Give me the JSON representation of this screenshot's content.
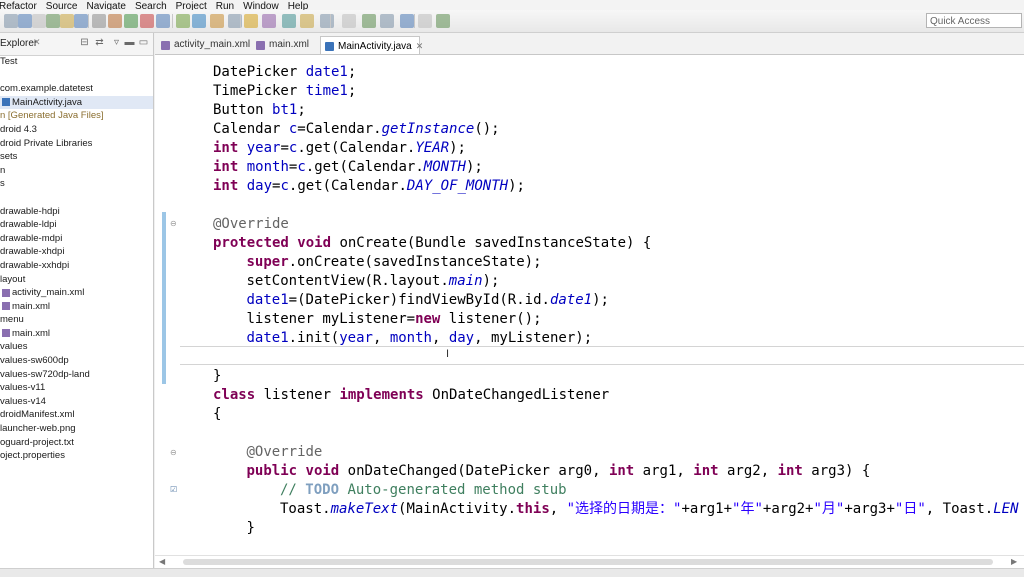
{
  "menu": [
    "Refactor",
    "Source",
    "Navigate",
    "Search",
    "Project",
    "Run",
    "Window",
    "Help"
  ],
  "toolbar": {
    "quick_access_placeholder": "Quick Access"
  },
  "explorer": {
    "tab_label": "Explorer",
    "close_glyph": "✕",
    "items": [
      {
        "label": "Test",
        "indent": 0,
        "icon": "project-icon"
      },
      {
        "label": "",
        "indent": 0,
        "icon": ""
      },
      {
        "label": "com.example.datetest",
        "indent": 0,
        "icon": "package-icon"
      },
      {
        "label": "MainActivity.java",
        "indent": 1,
        "icon": "java-file-icon",
        "selected": true
      },
      {
        "label": "n [Generated Java Files]",
        "indent": 0,
        "icon": "folder-icon",
        "generated": true
      },
      {
        "label": "droid 4.3",
        "indent": 0,
        "icon": "library-icon"
      },
      {
        "label": "droid Private Libraries",
        "indent": 0,
        "icon": "library-icon"
      },
      {
        "label": "sets",
        "indent": 0,
        "icon": "folder-icon"
      },
      {
        "label": "n",
        "indent": 0,
        "icon": "folder-icon"
      },
      {
        "label": "s",
        "indent": 0,
        "icon": "folder-icon"
      },
      {
        "label": "",
        "indent": 0,
        "icon": ""
      },
      {
        "label": "drawable-hdpi",
        "indent": 0,
        "icon": "folder-icon"
      },
      {
        "label": "drawable-ldpi",
        "indent": 0,
        "icon": "folder-icon"
      },
      {
        "label": "drawable-mdpi",
        "indent": 0,
        "icon": "folder-icon"
      },
      {
        "label": "drawable-xhdpi",
        "indent": 0,
        "icon": "folder-icon"
      },
      {
        "label": "drawable-xxhdpi",
        "indent": 0,
        "icon": "folder-icon"
      },
      {
        "label": "layout",
        "indent": 0,
        "icon": "folder-icon"
      },
      {
        "label": "activity_main.xml",
        "indent": 1,
        "icon": "xml-file-icon"
      },
      {
        "label": "main.xml",
        "indent": 1,
        "icon": "xml-file-icon"
      },
      {
        "label": "menu",
        "indent": 0,
        "icon": "folder-icon"
      },
      {
        "label": "main.xml",
        "indent": 1,
        "icon": "xml-file-icon"
      },
      {
        "label": "values",
        "indent": 0,
        "icon": "folder-icon"
      },
      {
        "label": "values-sw600dp",
        "indent": 0,
        "icon": "folder-icon"
      },
      {
        "label": "values-sw720dp-land",
        "indent": 0,
        "icon": "folder-icon"
      },
      {
        "label": "values-v11",
        "indent": 0,
        "icon": "folder-icon"
      },
      {
        "label": "values-v14",
        "indent": 0,
        "icon": "folder-icon"
      },
      {
        "label": "droidManifest.xml",
        "indent": 0,
        "icon": "xml-file-icon"
      },
      {
        "label": "launcher-web.png",
        "indent": 0,
        "icon": "image-file-icon"
      },
      {
        "label": "oguard-project.txt",
        "indent": 0,
        "icon": "text-file-icon"
      },
      {
        "label": "oject.properties",
        "indent": 0,
        "icon": "text-file-icon"
      }
    ]
  },
  "editor": {
    "tabs": [
      {
        "label": "activity_main.xml",
        "active": false
      },
      {
        "label": "main.xml",
        "active": false
      },
      {
        "label": "MainActivity.java",
        "active": true
      }
    ],
    "lines": [
      {
        "indent": 0,
        "tokens": [
          [
            "",
            "DatePicker "
          ],
          [
            "fld",
            "date1"
          ],
          [
            "",
            ";"
          ]
        ]
      },
      {
        "indent": 0,
        "tokens": [
          [
            "",
            "TimePicker "
          ],
          [
            "fld",
            "time1"
          ],
          [
            "",
            ";"
          ]
        ]
      },
      {
        "indent": 0,
        "tokens": [
          [
            "",
            "Button "
          ],
          [
            "fld",
            "bt1"
          ],
          [
            "",
            ";"
          ]
        ]
      },
      {
        "indent": 0,
        "tokens": [
          [
            "",
            "Calendar "
          ],
          [
            "fld",
            "c"
          ],
          [
            "",
            "=Calendar."
          ],
          [
            "stc",
            "getInstance"
          ],
          [
            "",
            "();"
          ]
        ]
      },
      {
        "indent": 0,
        "tokens": [
          [
            "kw",
            "int"
          ],
          [
            "",
            " "
          ],
          [
            "fld",
            "year"
          ],
          [
            "",
            "="
          ],
          [
            "fld",
            "c"
          ],
          [
            "",
            ".get(Calendar."
          ],
          [
            "stc",
            "YEAR"
          ],
          [
            "",
            ");"
          ]
        ]
      },
      {
        "indent": 0,
        "tokens": [
          [
            "kw",
            "int"
          ],
          [
            "",
            " "
          ],
          [
            "fld",
            "month"
          ],
          [
            "",
            "="
          ],
          [
            "fld",
            "c"
          ],
          [
            "",
            ".get(Calendar."
          ],
          [
            "stc",
            "MONTH"
          ],
          [
            "",
            ");"
          ]
        ]
      },
      {
        "indent": 0,
        "tokens": [
          [
            "kw",
            "int"
          ],
          [
            "",
            " "
          ],
          [
            "fld",
            "day"
          ],
          [
            "",
            "="
          ],
          [
            "fld",
            "c"
          ],
          [
            "",
            ".get(Calendar."
          ],
          [
            "stc",
            "DAY_OF_MONTH"
          ],
          [
            "",
            ");"
          ]
        ]
      },
      {
        "indent": 0,
        "tokens": []
      },
      {
        "indent": 0,
        "tokens": [
          [
            "ann",
            "@Override"
          ]
        ]
      },
      {
        "indent": 0,
        "tokens": [
          [
            "kw",
            "protected"
          ],
          [
            "",
            " "
          ],
          [
            "kw",
            "void"
          ],
          [
            "",
            " onCreate(Bundle savedInstanceState) {"
          ]
        ]
      },
      {
        "indent": 1,
        "tokens": [
          [
            "kw",
            "super"
          ],
          [
            "",
            ".onCreate(savedInstanceState);"
          ]
        ]
      },
      {
        "indent": 1,
        "tokens": [
          [
            "",
            "setContentView(R.layout."
          ],
          [
            "stc",
            "main"
          ],
          [
            "",
            ");"
          ]
        ]
      },
      {
        "indent": 1,
        "tokens": [
          [
            "fld",
            "date1"
          ],
          [
            "",
            "=(DatePicker)findViewById(R.id."
          ],
          [
            "stc",
            "date1"
          ],
          [
            "",
            ");"
          ]
        ]
      },
      {
        "indent": 1,
        "tokens": [
          [
            "",
            "listener myListener="
          ],
          [
            "kw",
            "new"
          ],
          [
            "",
            " listener();"
          ]
        ]
      },
      {
        "indent": 1,
        "tokens": [
          [
            "fld",
            "date1"
          ],
          [
            "",
            ".init("
          ],
          [
            "fld",
            "year"
          ],
          [
            "",
            ", "
          ],
          [
            "fld",
            "month"
          ],
          [
            "",
            ", "
          ],
          [
            "fld",
            "day"
          ],
          [
            "",
            ", myListener);"
          ]
        ]
      },
      {
        "indent": 1,
        "tokens": []
      },
      {
        "indent": 0,
        "tokens": [
          [
            "",
            "}"
          ]
        ]
      },
      {
        "indent": 0,
        "tokens": [
          [
            "kw",
            "class"
          ],
          [
            "",
            " listener "
          ],
          [
            "kw",
            "implements"
          ],
          [
            "",
            " OnDateChangedListener"
          ]
        ]
      },
      {
        "indent": 0,
        "tokens": [
          [
            "",
            "{"
          ]
        ]
      },
      {
        "indent": 0,
        "tokens": []
      },
      {
        "indent": 1,
        "tokens": [
          [
            "ann",
            "@Override"
          ]
        ]
      },
      {
        "indent": 1,
        "tokens": [
          [
            "kw",
            "public"
          ],
          [
            "",
            " "
          ],
          [
            "kw",
            "void"
          ],
          [
            "",
            " onDateChanged(DatePicker arg0, "
          ],
          [
            "kw",
            "int"
          ],
          [
            "",
            " arg1, "
          ],
          [
            "kw",
            "int"
          ],
          [
            "",
            " arg2, "
          ],
          [
            "kw",
            "int"
          ],
          [
            "",
            " arg3) {"
          ]
        ]
      },
      {
        "indent": 2,
        "tokens": [
          [
            "cmt",
            "// "
          ],
          [
            "todo",
            "TODO"
          ],
          [
            "cmt",
            " Auto-generated method stub"
          ]
        ]
      },
      {
        "indent": 2,
        "tokens": [
          [
            "",
            "Toast."
          ],
          [
            "stc",
            "makeText"
          ],
          [
            "",
            "(MainActivity."
          ],
          [
            "kw",
            "this"
          ],
          [
            "",
            ", "
          ],
          [
            "str",
            "\"选择的日期是：\""
          ],
          [
            "",
            "+arg1+"
          ],
          [
            "str",
            "\"年\""
          ],
          [
            "",
            "+arg2+"
          ],
          [
            "str",
            "\"月\""
          ],
          [
            "",
            "+arg3+"
          ],
          [
            "str",
            "\"日\""
          ],
          [
            "",
            ", Toast."
          ],
          [
            "stc",
            "LEN"
          ]
        ]
      },
      {
        "indent": 1,
        "tokens": [
          [
            "",
            "}"
          ]
        ]
      }
    ]
  },
  "colors": {
    "keyword": "#7f0055",
    "field": "#0000c0",
    "annotation": "#646464",
    "comment": "#3f7f5f",
    "string": "#2a00ff",
    "change_bar": "#9cc6e6"
  }
}
